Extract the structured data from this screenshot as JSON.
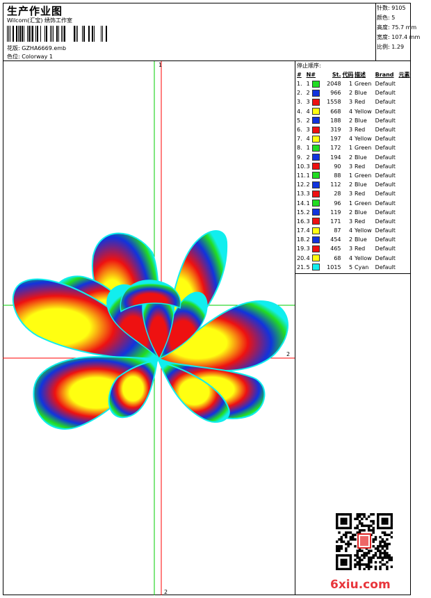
{
  "header": {
    "title": "生产作业图",
    "subtitle": "Wilcom(汇宝) 绣饰工作室",
    "file_label": "花版:",
    "file_name": "GZHA6669.emb",
    "colorway_label": "色位:",
    "colorway_name": "Colorway 1"
  },
  "stats": {
    "stitches": "针数: 9105",
    "colors": "颜色: 5",
    "height": "高度: 75.7 mm",
    "width": "宽度: 107.4 mm",
    "scale": "比例: 1.29"
  },
  "canvas": {
    "axis_top_label": "1",
    "axis_right_label": "2",
    "axis_bottom_label": "2"
  },
  "stop_sequence": {
    "title": "停止顺序:",
    "columns": [
      "#",
      "N#",
      "St.",
      "代码",
      "描述",
      "Brand",
      "元素"
    ],
    "rows": [
      {
        "idx": "1.",
        "n": "1",
        "color": "#22dd22",
        "st": "2048",
        "code": "1",
        "desc": "Green",
        "brand": "Default"
      },
      {
        "idx": "2.",
        "n": "2",
        "color": "#1133dd",
        "st": "966",
        "code": "2",
        "desc": "Blue",
        "brand": "Default"
      },
      {
        "idx": "3.",
        "n": "3",
        "color": "#ee1111",
        "st": "1558",
        "code": "3",
        "desc": "Red",
        "brand": "Default"
      },
      {
        "idx": "4.",
        "n": "4",
        "color": "#ffff11",
        "st": "668",
        "code": "4",
        "desc": "Yellow",
        "brand": "Default"
      },
      {
        "idx": "5.",
        "n": "2",
        "color": "#1133dd",
        "st": "188",
        "code": "2",
        "desc": "Blue",
        "brand": "Default"
      },
      {
        "idx": "6.",
        "n": "3",
        "color": "#ee1111",
        "st": "319",
        "code": "3",
        "desc": "Red",
        "brand": "Default"
      },
      {
        "idx": "7.",
        "n": "4",
        "color": "#ffff11",
        "st": "197",
        "code": "4",
        "desc": "Yellow",
        "brand": "Default"
      },
      {
        "idx": "8.",
        "n": "1",
        "color": "#22dd22",
        "st": "172",
        "code": "1",
        "desc": "Green",
        "brand": "Default"
      },
      {
        "idx": "9.",
        "n": "2",
        "color": "#1133dd",
        "st": "194",
        "code": "2",
        "desc": "Blue",
        "brand": "Default"
      },
      {
        "idx": "10.",
        "n": "3",
        "color": "#ee1111",
        "st": "90",
        "code": "3",
        "desc": "Red",
        "brand": "Default"
      },
      {
        "idx": "11.",
        "n": "1",
        "color": "#22dd22",
        "st": "88",
        "code": "1",
        "desc": "Green",
        "brand": "Default"
      },
      {
        "idx": "12.",
        "n": "2",
        "color": "#1133dd",
        "st": "112",
        "code": "2",
        "desc": "Blue",
        "brand": "Default"
      },
      {
        "idx": "13.",
        "n": "3",
        "color": "#ee1111",
        "st": "28",
        "code": "3",
        "desc": "Red",
        "brand": "Default"
      },
      {
        "idx": "14.",
        "n": "1",
        "color": "#22dd22",
        "st": "96",
        "code": "1",
        "desc": "Green",
        "brand": "Default"
      },
      {
        "idx": "15.",
        "n": "2",
        "color": "#1133dd",
        "st": "119",
        "code": "2",
        "desc": "Blue",
        "brand": "Default"
      },
      {
        "idx": "16.",
        "n": "3",
        "color": "#ee1111",
        "st": "171",
        "code": "3",
        "desc": "Red",
        "brand": "Default"
      },
      {
        "idx": "17.",
        "n": "4",
        "color": "#ffff11",
        "st": "87",
        "code": "4",
        "desc": "Yellow",
        "brand": "Default"
      },
      {
        "idx": "18.",
        "n": "2",
        "color": "#1133dd",
        "st": "454",
        "code": "2",
        "desc": "Blue",
        "brand": "Default"
      },
      {
        "idx": "19.",
        "n": "3",
        "color": "#ee1111",
        "st": "465",
        "code": "3",
        "desc": "Red",
        "brand": "Default"
      },
      {
        "idx": "20.",
        "n": "4",
        "color": "#ffff11",
        "st": "68",
        "code": "4",
        "desc": "Yellow",
        "brand": "Default"
      },
      {
        "idx": "21.",
        "n": "5",
        "color": "#11eeee",
        "st": "1015",
        "code": "5",
        "desc": "Cyan",
        "brand": "Default"
      }
    ]
  },
  "watermark": "6xiu.com",
  "colors": {
    "green": "#22dd22",
    "blue": "#1133dd",
    "red": "#ee1111",
    "yellow": "#ffff11",
    "cyan": "#11eeee",
    "guide_red": "#ff0000",
    "guide_green": "#00cc00"
  }
}
